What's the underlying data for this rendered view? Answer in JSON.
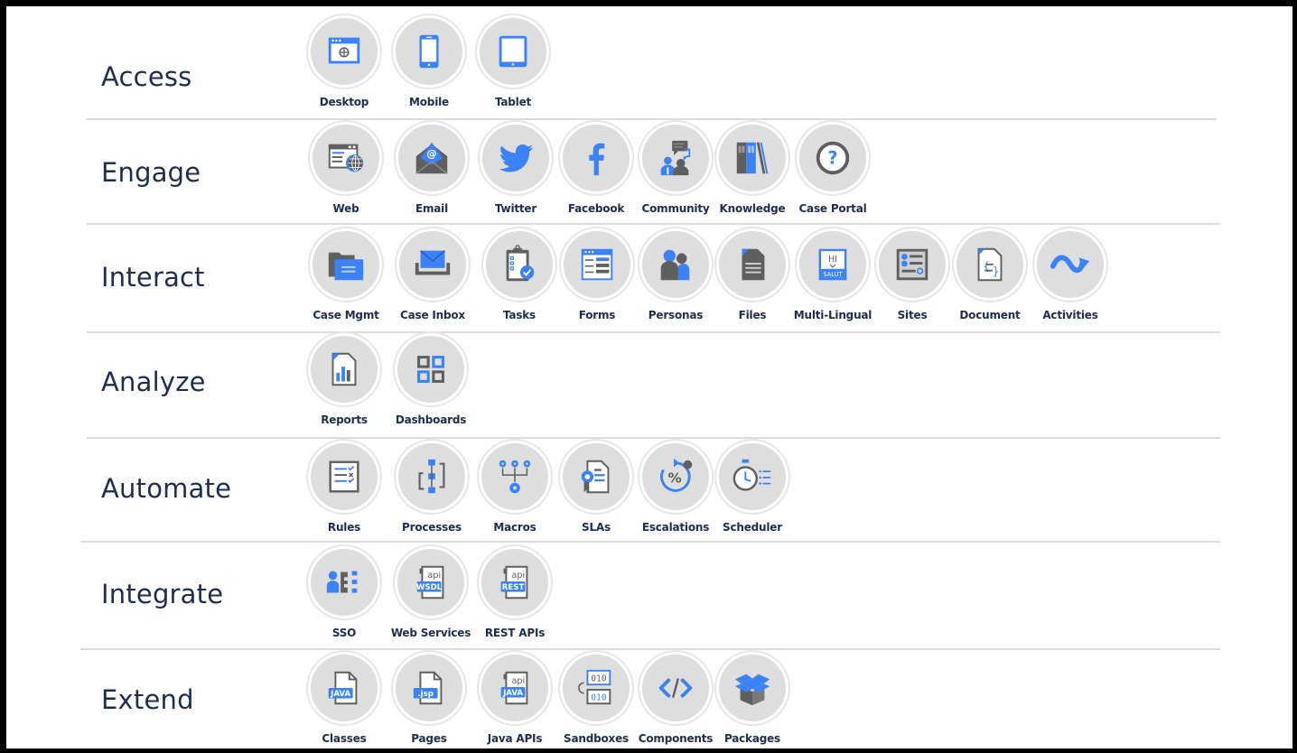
{
  "colors": {
    "accent": "#3b82f6",
    "dark_icon": "#5f5f5f",
    "text": "#1f2d4f",
    "circle_fill": "#dedede",
    "divider": "#dcdcdc"
  },
  "categories": [
    {
      "title": "Access",
      "items": [
        {
          "label": "Desktop",
          "icon": "desktop-browser-icon"
        },
        {
          "label": "Mobile",
          "icon": "mobile-phone-icon"
        },
        {
          "label": "Tablet",
          "icon": "tablet-icon"
        }
      ]
    },
    {
      "title": "Engage",
      "items": [
        {
          "label": "Web",
          "icon": "web-globe-icon"
        },
        {
          "label": "Email",
          "icon": "email-envelope-icon"
        },
        {
          "label": "Twitter",
          "icon": "twitter-bird-icon"
        },
        {
          "label": "Facebook",
          "icon": "facebook-icon"
        },
        {
          "label": "Community",
          "icon": "community-chat-icon"
        },
        {
          "label": "Knowledge",
          "icon": "knowledge-books-icon"
        },
        {
          "label": "Case Portal",
          "icon": "question-mark-icon"
        }
      ]
    },
    {
      "title": "Interact",
      "items": [
        {
          "label": "Case Mgmt",
          "icon": "folder-icon"
        },
        {
          "label": "Case Inbox",
          "icon": "inbox-icon"
        },
        {
          "label": "Tasks",
          "icon": "clipboard-check-icon"
        },
        {
          "label": "Forms",
          "icon": "form-icon"
        },
        {
          "label": "Personas",
          "icon": "personas-icon"
        },
        {
          "label": "Files",
          "icon": "file-icon"
        },
        {
          "label": "Multi-Lingual",
          "icon": "translate-icon",
          "icon_text_top": "HI",
          "icon_text_bottom": "SALUT"
        },
        {
          "label": "Sites",
          "icon": "sites-list-icon"
        },
        {
          "label": "Document",
          "icon": "document-code-icon"
        },
        {
          "label": "Activities",
          "icon": "activity-arrow-icon"
        }
      ]
    },
    {
      "title": "Analyze",
      "items": [
        {
          "label": "Reports",
          "icon": "report-chart-icon"
        },
        {
          "label": "Dashboards",
          "icon": "dashboard-grid-icon"
        }
      ]
    },
    {
      "title": "Automate",
      "items": [
        {
          "label": "Rules",
          "icon": "rules-checklist-icon"
        },
        {
          "label": "Processes",
          "icon": "process-flow-icon"
        },
        {
          "label": "Macros",
          "icon": "macro-gears-icon"
        },
        {
          "label": "SLAs",
          "icon": "sla-certificate-icon"
        },
        {
          "label": "Escalations",
          "icon": "escalation-percent-icon"
        },
        {
          "label": "Scheduler",
          "icon": "stopwatch-icon"
        }
      ]
    },
    {
      "title": "Integrate",
      "items": [
        {
          "label": "SSO",
          "icon": "sso-icon"
        },
        {
          "label": "Web Services",
          "icon": "api-wsdl-icon",
          "icon_text_top": "api",
          "icon_text_bottom": "WSDL"
        },
        {
          "label": "REST APIs",
          "icon": "api-rest-icon",
          "icon_text_top": "api",
          "icon_text_bottom": "REST"
        }
      ]
    },
    {
      "title": "Extend",
      "items": [
        {
          "label": "Classes",
          "icon": "java-file-icon",
          "icon_text_bottom": "JAVA"
        },
        {
          "label": "Pages",
          "icon": "jsp-file-icon",
          "icon_text_bottom": ".jsp"
        },
        {
          "label": "Java APIs",
          "icon": "api-java-icon",
          "icon_text_top": "api",
          "icon_text_bottom": "JAVA"
        },
        {
          "label": "Sandboxes",
          "icon": "sandbox-binary-icon",
          "icon_text_top": "010",
          "icon_text_bottom": "010"
        },
        {
          "label": "Components",
          "icon": "code-brackets-icon",
          "icon_text_top": "</>"
        },
        {
          "label": "Packages",
          "icon": "package-box-icon"
        }
      ]
    }
  ]
}
